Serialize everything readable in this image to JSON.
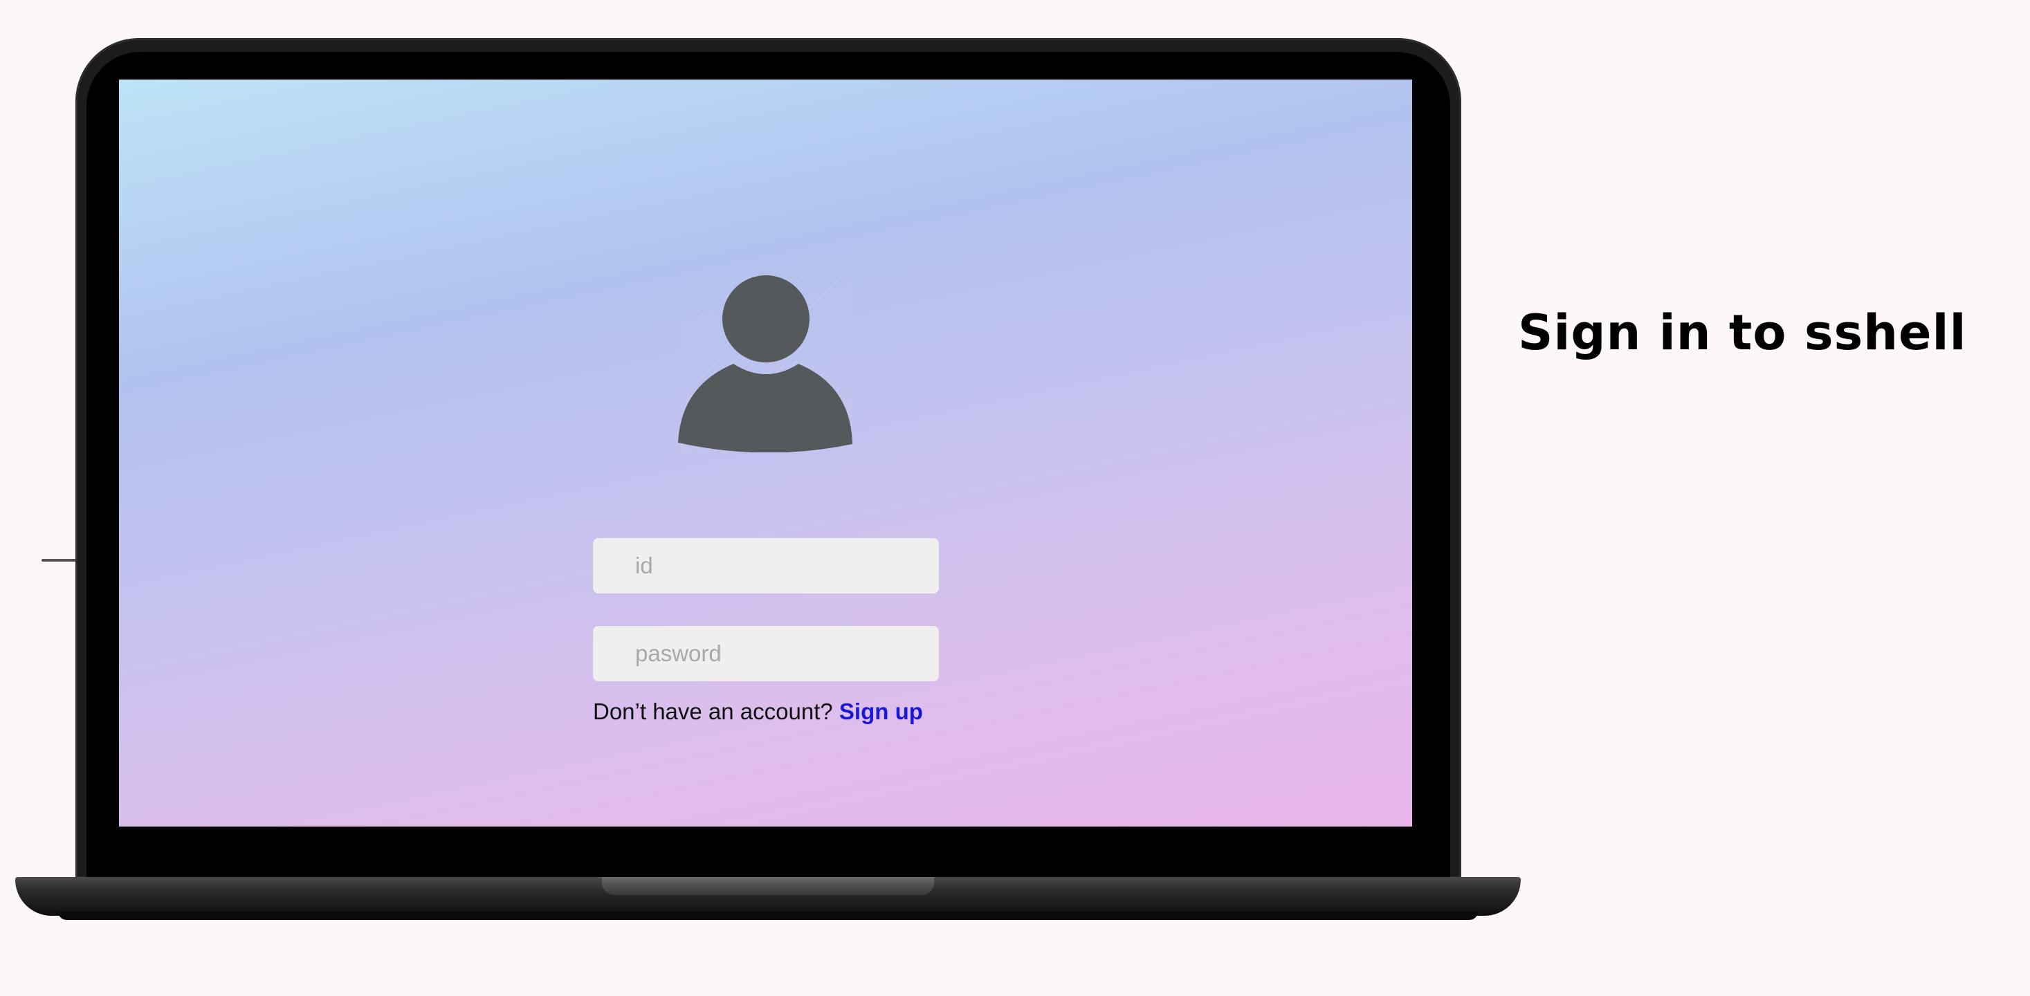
{
  "heading": {
    "title": "Sign in to sshell"
  },
  "login": {
    "avatar_icon": "user-icon",
    "id_field": {
      "placeholder": "id",
      "value": ""
    },
    "password_field": {
      "placeholder": "pasword",
      "value": ""
    },
    "signup_prompt": "Don’t have an account?",
    "signup_link": "Sign up"
  },
  "colors": {
    "page_background": "#fdf7f7",
    "screen_gradient_top": "#bde3f7",
    "screen_gradient_bottom": "#eab5ec",
    "input_background": "#efefef",
    "avatar": "#56595b",
    "link": "#1a1ad6"
  }
}
